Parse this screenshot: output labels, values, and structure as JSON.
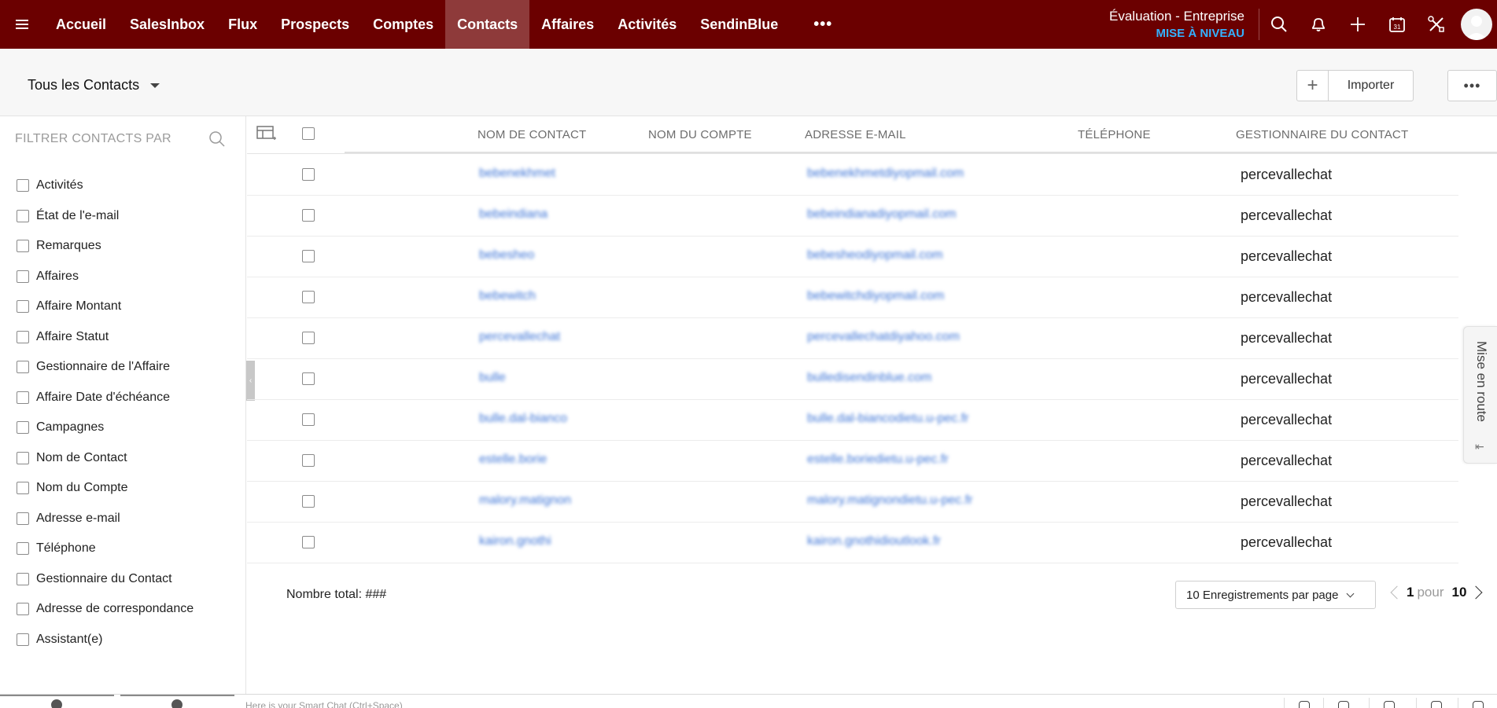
{
  "nav": {
    "items": [
      {
        "label": "Accueil",
        "active": false
      },
      {
        "label": "SalesInbox",
        "active": false
      },
      {
        "label": "Flux",
        "active": false
      },
      {
        "label": "Prospects",
        "active": false
      },
      {
        "label": "Comptes",
        "active": false
      },
      {
        "label": "Contacts",
        "active": true
      },
      {
        "label": "Affaires",
        "active": false
      },
      {
        "label": "Activités",
        "active": false
      },
      {
        "label": "SendinBlue",
        "active": false
      }
    ],
    "more_label": "•••",
    "plan_name": "Évaluation - Entreprise",
    "upgrade_label": "MISE À NIVEAU",
    "icons": [
      "search-icon",
      "bell-icon",
      "plus-icon",
      "calendar-icon",
      "tools-icon",
      "avatar"
    ],
    "calendar_day": "31"
  },
  "subheader": {
    "view_label": "Tous les Contacts",
    "plus_label": "+",
    "import_label": "Importer",
    "more_label": "•••"
  },
  "sidebar": {
    "heading": "FILTRER CONTACTS PAR",
    "filters": [
      "Activités",
      "État de l'e-mail",
      "Remarques",
      "Affaires",
      "Affaire Montant",
      "Affaire Statut",
      "Gestionnaire de l'Affaire",
      "Affaire Date d'échéance",
      "Campagnes",
      "Nom de Contact",
      "Nom du Compte",
      "Adresse e-mail",
      "Téléphone",
      "Gestionnaire du Contact",
      "Adresse de correspondance",
      "Assistant(e)"
    ]
  },
  "table": {
    "columns": {
      "contact_name": "NOM DE CONTACT",
      "account_name": "NOM DU COMPTE",
      "email": "ADRESSE E-MAIL",
      "phone": "TÉLÉPHONE",
      "owner": "GESTIONNAIRE DU CONTACT"
    },
    "rows": [
      {
        "name": "bebenekhmet",
        "email": "bebenekhmetdiyopmail.com",
        "owner": "percevallechat"
      },
      {
        "name": "bebeindiana",
        "email": "bebeindianadiyopmail.com",
        "owner": "percevallechat"
      },
      {
        "name": "bebesheo",
        "email": "bebesheodiyopmail.com",
        "owner": "percevallechat"
      },
      {
        "name": "bebewitch",
        "email": "bebewitchdiyopmail.com",
        "owner": "percevallechat"
      },
      {
        "name": "percevallechat",
        "email": "percevallechatdiyahoo.com",
        "owner": "percevallechat"
      },
      {
        "name": "bulle",
        "email": "bulledisendinblue.com",
        "owner": "percevallechat"
      },
      {
        "name": "bulle.dal-bianco",
        "email": "bulle.dal-biancodietu.u-pec.fr",
        "owner": "percevallechat"
      },
      {
        "name": "estelle.borie",
        "email": "estelle.boriedietu.u-pec.fr",
        "owner": "percevallechat"
      },
      {
        "name": "malory.matignon",
        "email": "malory.matignondietu.u-pec.fr",
        "owner": "percevallechat"
      },
      {
        "name": "kairon.gnothi",
        "email": "kairon.gnothidioutlook.fr",
        "owner": "percevallechat"
      }
    ],
    "total_label": "Nombre total: ###",
    "per_page_label": "10 Enregistrements par page",
    "pager": {
      "current": "1",
      "word": "pour",
      "total": "10"
    }
  },
  "side_tab": {
    "label": "Mise en route",
    "icon": "collapse-left-icon"
  },
  "bottom": {
    "chat_placeholder": "Here is your Smart Chat (Ctrl+Space)"
  }
}
